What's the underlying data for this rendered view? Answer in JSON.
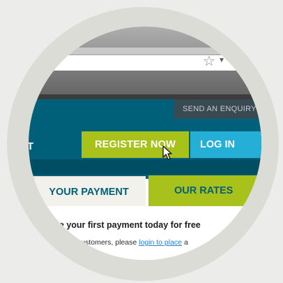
{
  "header": {
    "enquiry_label": "SEND AN ENQUIRY",
    "nav_fragment": "T",
    "register_label": "REGISTER NOW",
    "login_label": "LOG IN"
  },
  "tabs": [
    {
      "label": "YOUR PAYMENT",
      "active": true
    },
    {
      "label": "OUR RATES",
      "active": false
    }
  ],
  "content": {
    "headline": "ake your first payment today for free",
    "line_prefix": "customers, please",
    "link_text": "login to place",
    "line_suffix": "a"
  },
  "icons": [
    "bookmark-star-icon",
    "dropdown-arrow-icon",
    "mouse-cursor-icon"
  ],
  "colors": {
    "brand_teal": "#006079",
    "accent_green": "#a9c21b",
    "accent_blue": "#25afd6"
  }
}
